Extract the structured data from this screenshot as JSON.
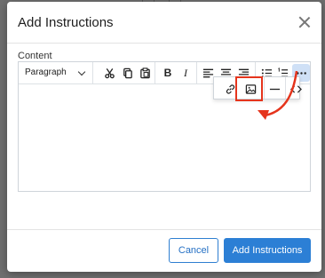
{
  "dialog": {
    "title": "Add Instructions",
    "close_icon": "close-icon"
  },
  "content_field": {
    "label": "Content"
  },
  "toolbar": {
    "format_value": "Paragraph",
    "buttons": [
      {
        "name": "cut-icon"
      },
      {
        "name": "copy-icon"
      },
      {
        "name": "paste-icon"
      },
      {
        "name": "bold-icon",
        "glyph": "B"
      },
      {
        "name": "italic-icon",
        "glyph": "I"
      },
      {
        "name": "align-left-icon"
      },
      {
        "name": "align-center-icon"
      },
      {
        "name": "align-right-icon"
      },
      {
        "name": "bullet-list-icon"
      },
      {
        "name": "numbered-list-icon"
      },
      {
        "name": "more-icon"
      }
    ],
    "overflow": [
      {
        "name": "link-icon"
      },
      {
        "name": "image-icon"
      },
      {
        "name": "horizontal-rule-icon"
      },
      {
        "name": "code-icon"
      }
    ]
  },
  "actions": {
    "cancel_label": "Cancel",
    "submit_label": "Add Instructions"
  },
  "colors": {
    "primary": "#2c7fd5",
    "highlight": "#e5341c",
    "active_toolbar": "#cfe0f6"
  }
}
